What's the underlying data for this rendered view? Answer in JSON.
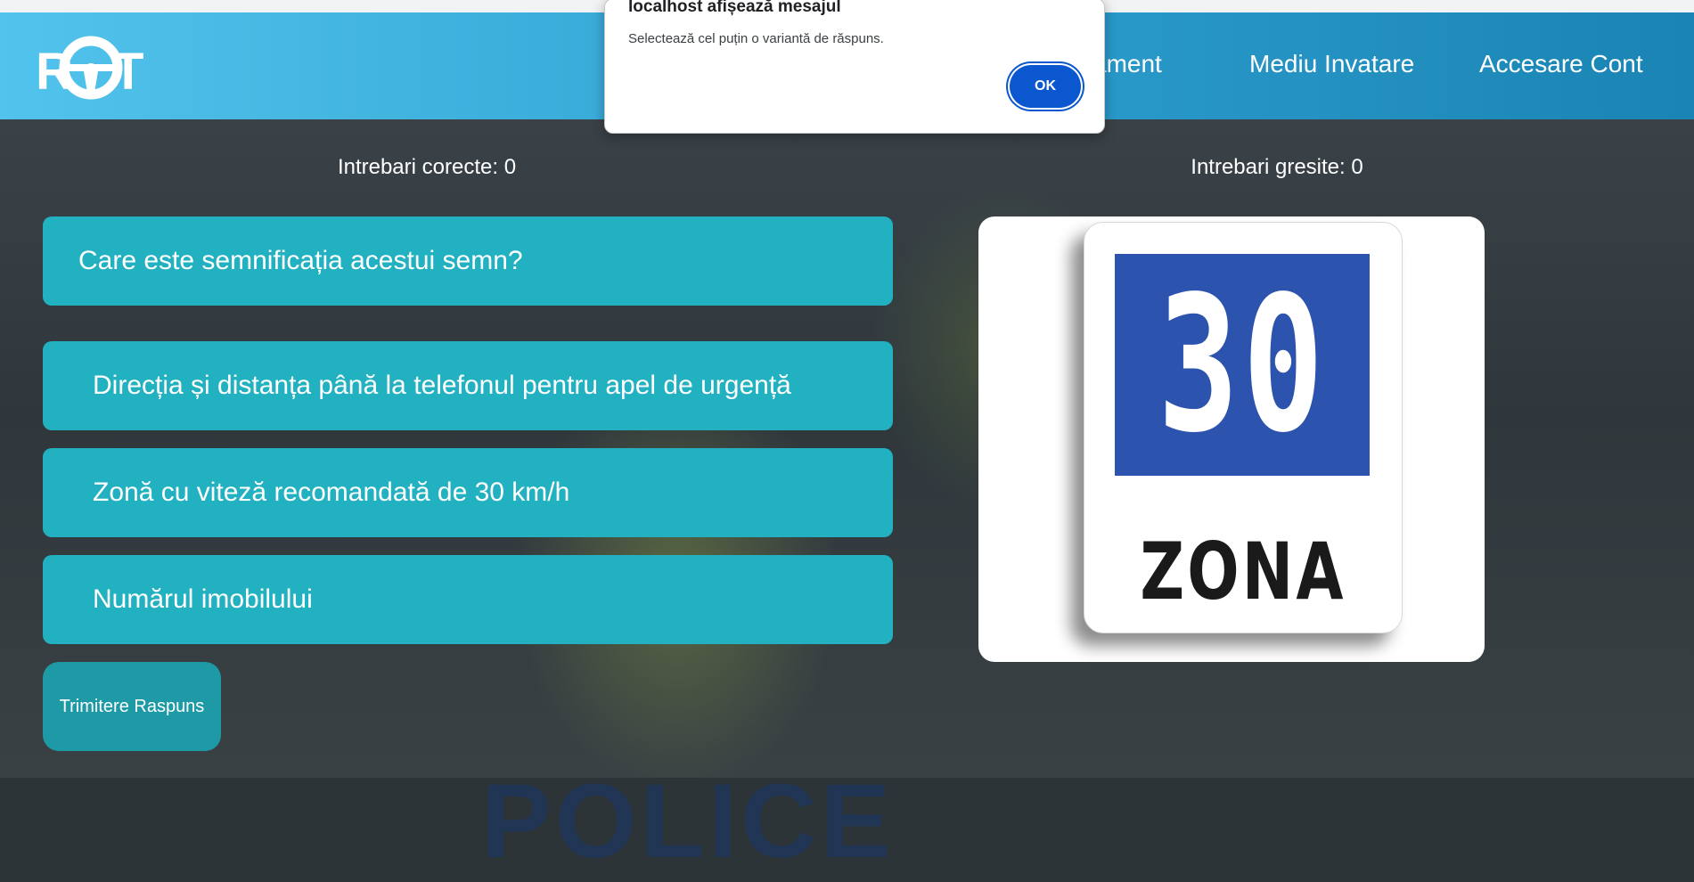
{
  "browser_dialog": {
    "title": "localhost afișează mesajul",
    "message": "Selectează cel puțin o variantă de răspuns.",
    "ok_label": "OK"
  },
  "navbar": {
    "logo_text": "ROT",
    "items": [
      {
        "label": "sament"
      },
      {
        "label": "Mediu Invatare"
      },
      {
        "label": "Accesare Cont"
      }
    ]
  },
  "scores": {
    "correct": "Intrebari corecte: 0",
    "wrong": "Intrebari gresite: 0"
  },
  "quiz": {
    "question": "Care este semnificația acestui semn?",
    "answers": [
      {
        "label": "Direcția și distanța până la telefonul pentru apel de urgență"
      },
      {
        "label": "Zonă cu viteză recomandată de 30 km/h"
      },
      {
        "label": "Numărul imobilului"
      }
    ],
    "submit_label": "Trimitere Raspuns"
  },
  "sign": {
    "number": "30",
    "zone_text": "ZONA",
    "blue_color": "#2c53ad"
  },
  "background": {
    "text": "POLICE"
  },
  "colors": {
    "navbar_start": "#51c3ec",
    "navbar_end": "#1a84b4",
    "answer_box": "#22b1c1",
    "submit_button": "#1e9aa6",
    "dialog_ok": "#0b57d0"
  }
}
